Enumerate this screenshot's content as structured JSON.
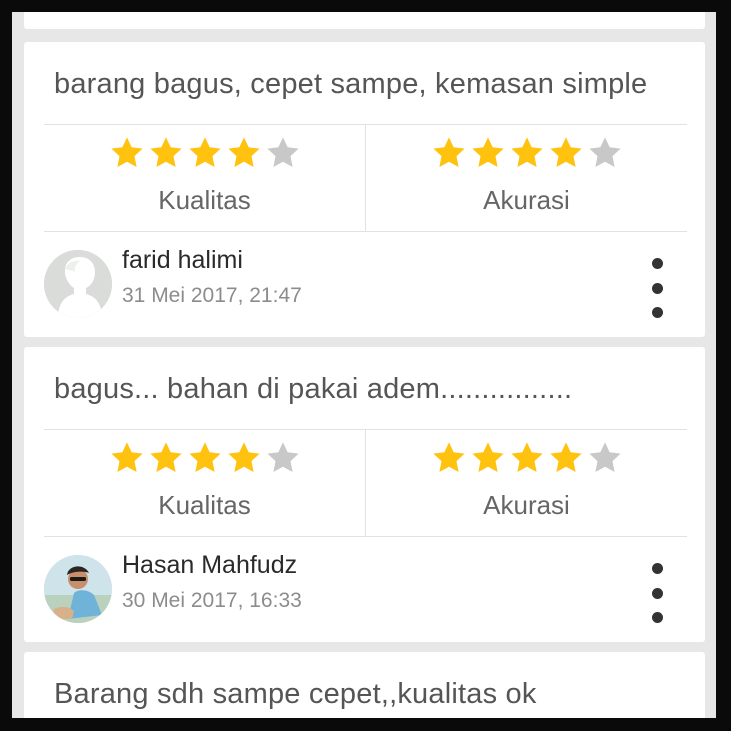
{
  "colors": {
    "star_filled": "#FFC20E",
    "star_empty": "#C8C8C8",
    "card_bg": "#FFFFFF",
    "page_bg": "#E7E7E7"
  },
  "reviews": [
    {
      "text": "barang bagus, cepet sampe, kemasan simple",
      "ratings": [
        {
          "label": "Kualitas",
          "stars": 4,
          "max": 5
        },
        {
          "label": "Akurasi",
          "stars": 4,
          "max": 5
        }
      ],
      "reviewer": {
        "name": "farid halimi",
        "date": "31 Mei 2017, 21:47",
        "avatar": "default-avatar"
      }
    },
    {
      "text": "bagus... bahan di pakai adem................",
      "ratings": [
        {
          "label": "Kualitas",
          "stars": 4,
          "max": 5
        },
        {
          "label": "Akurasi",
          "stars": 4,
          "max": 5
        }
      ],
      "reviewer": {
        "name": "Hasan Mahfudz",
        "date": "30 Mei 2017, 16:33",
        "avatar": "photo-avatar"
      }
    },
    {
      "text": "Barang sdh sampe cepet,,kualitas ok"
    }
  ],
  "icons": {
    "menu": "more-vertical-icon",
    "star": "star-icon"
  }
}
